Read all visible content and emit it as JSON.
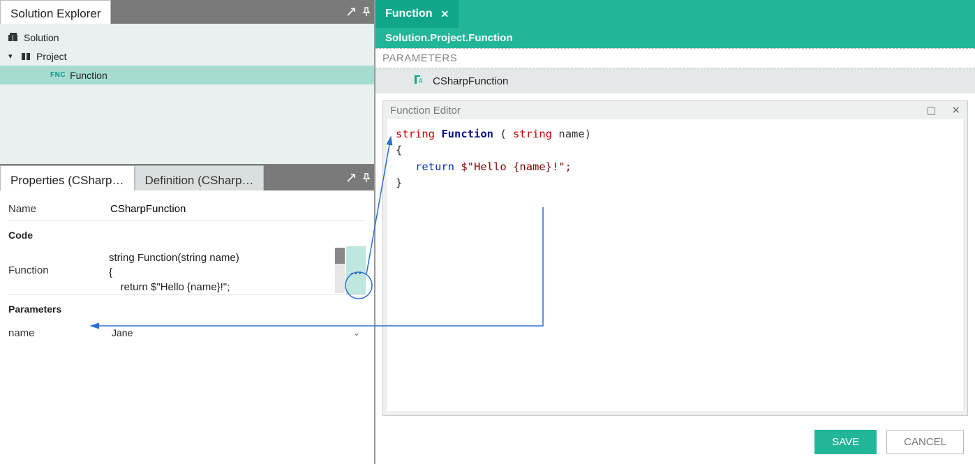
{
  "explorer": {
    "title": "Solution Explorer",
    "items": {
      "solution": "Solution",
      "project": "Project",
      "function": "Function",
      "fnc_badge": "FNC"
    }
  },
  "props": {
    "tab_properties": "Properties (CSharp…",
    "tab_definition": "Definition (CSharp…",
    "name_label": "Name",
    "name_value": "CSharpFunction",
    "code_label": "Code",
    "function_label": "Function",
    "code_preview": "string Function(string name)\n{\n    return $\"Hello {name}!\";",
    "ellipsis": "…",
    "parameters_label": "Parameters",
    "param_name_label": "name",
    "param_name_value": "Jane"
  },
  "doc": {
    "tab_label": "Function",
    "breadcrumb": "Solution.Project.Function",
    "parameters_bar": "PARAMETERS",
    "csharp_label": "CSharpFunction"
  },
  "editor": {
    "title": "Function Editor",
    "sig_type": "string",
    "sig_name": "Function",
    "sig_open": "(",
    "sig_ptype": "string",
    "sig_pname": " name)",
    "brace_open": "{",
    "ret_kw": "return",
    "ret_rest": " $\"Hello {name}!\";",
    "brace_close": "}"
  },
  "buttons": {
    "save": "SAVE",
    "cancel": "CANCEL"
  }
}
